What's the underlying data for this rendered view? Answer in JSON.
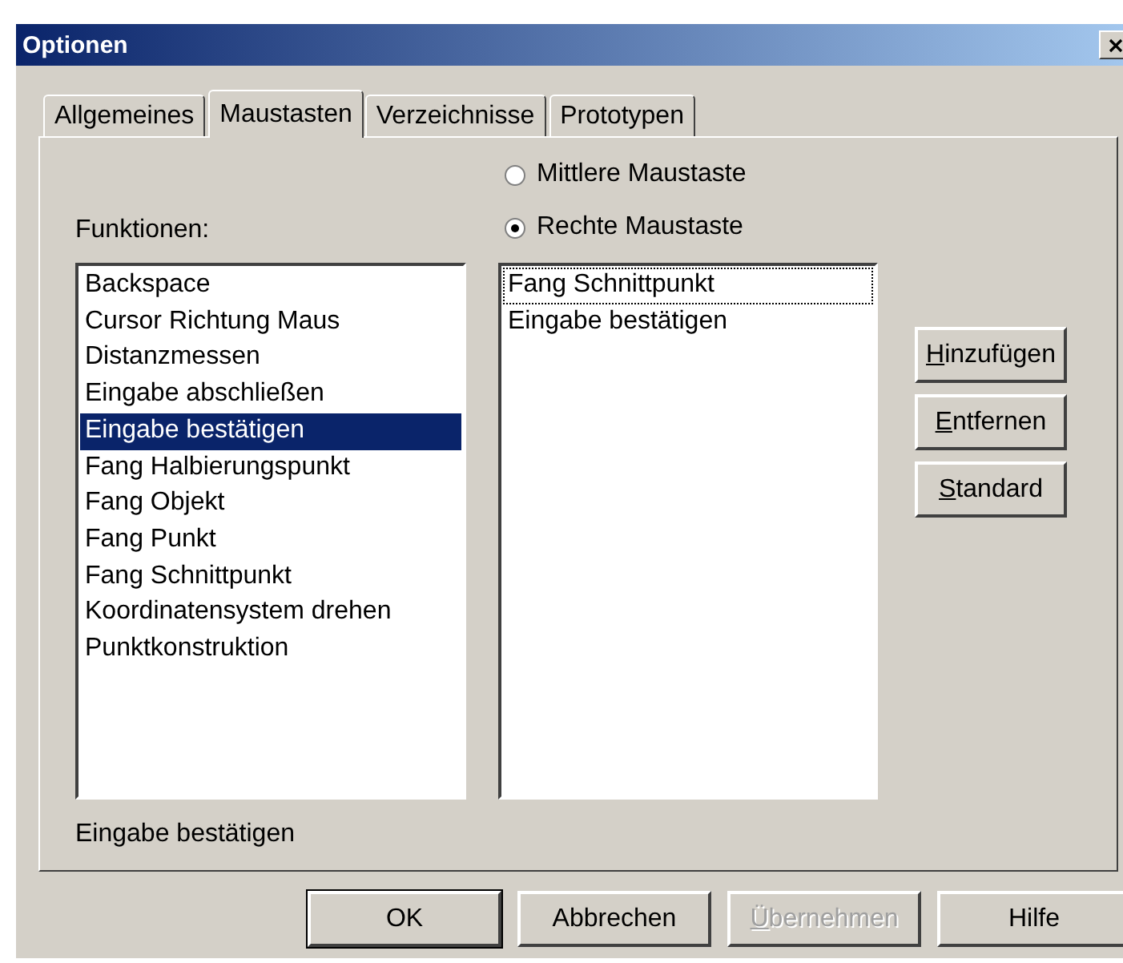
{
  "window": {
    "title": "Optionen"
  },
  "tabs": [
    {
      "label": "Allgemeines",
      "selected": false
    },
    {
      "label": "Maustasten",
      "selected": true
    },
    {
      "label": "Verzeichnisse",
      "selected": false
    },
    {
      "label": "Prototypen",
      "selected": false
    }
  ],
  "mouse_buttons": [
    {
      "label": "Mittlere Maustaste",
      "selected": false
    },
    {
      "label": "Rechte Maustaste",
      "selected": true
    }
  ],
  "functions": {
    "label": "Funktionen:",
    "items": [
      {
        "label": "Backspace",
        "selected": false
      },
      {
        "label": "Cursor Richtung Maus",
        "selected": false
      },
      {
        "label": "Distanzmessen",
        "selected": false
      },
      {
        "label": "Eingabe abschließen",
        "selected": false
      },
      {
        "label": "Eingabe bestätigen",
        "selected": true
      },
      {
        "label": "Fang Halbierungspunkt",
        "selected": false
      },
      {
        "label": "Fang Objekt",
        "selected": false
      },
      {
        "label": "Fang Punkt",
        "selected": false
      },
      {
        "label": "Fang Schnittpunkt",
        "selected": false
      },
      {
        "label": "Koordinatensystem drehen",
        "selected": false
      },
      {
        "label": "Punktkonstruktion",
        "selected": false
      }
    ]
  },
  "assigned": {
    "items": [
      {
        "label": "Fang Schnittpunkt",
        "focused": true
      },
      {
        "label": "Eingabe bestätigen",
        "focused": false
      }
    ]
  },
  "side_buttons": [
    {
      "label": "Hinzufügen",
      "mnemonic": true
    },
    {
      "label": "Entfernen",
      "mnemonic": true
    },
    {
      "label": "Standard",
      "mnemonic": true
    }
  ],
  "status_text": "Eingabe bestätigen",
  "buttons": [
    {
      "label": "OK",
      "default": true,
      "disabled": false,
      "mnemonic": false
    },
    {
      "label": "Abbrechen",
      "default": false,
      "disabled": false,
      "mnemonic": false
    },
    {
      "label": "Übernehmen",
      "default": false,
      "disabled": true,
      "mnemonic": true
    },
    {
      "label": "Hilfe",
      "default": false,
      "disabled": false,
      "mnemonic": false
    }
  ]
}
